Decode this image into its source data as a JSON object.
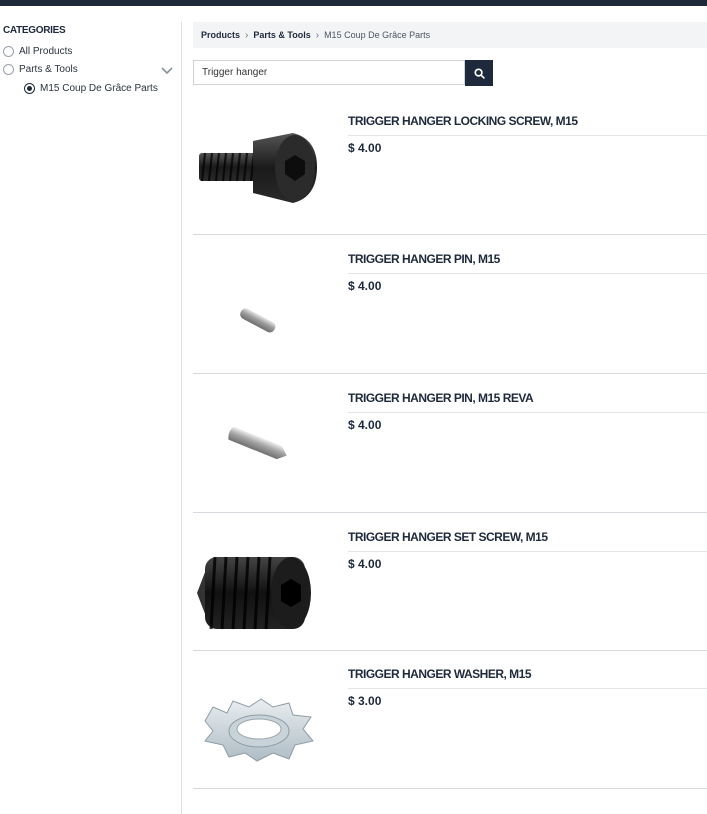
{
  "sidebar": {
    "title": "CATEGORIES",
    "items": [
      {
        "label": "All Products",
        "checked": false
      },
      {
        "label": "Parts & Tools",
        "checked": false
      },
      {
        "label": "M15 Coup De Grâce Parts",
        "checked": true
      }
    ]
  },
  "breadcrumb": {
    "items": [
      "Products",
      "Parts & Tools"
    ],
    "current": "M15 Coup De Grâce Parts"
  },
  "search": {
    "value": "Trigger hanger",
    "icon": "search-icon"
  },
  "products": [
    {
      "name": "TRIGGER HANGER LOCKING SCREW, M15",
      "price": "$ 4.00",
      "image": "socket-head-screw"
    },
    {
      "name": "TRIGGER HANGER PIN, M15",
      "price": "$ 4.00",
      "image": "small-pin"
    },
    {
      "name": "TRIGGER HANGER PIN, M15 REVA",
      "price": "$ 4.00",
      "image": "pin"
    },
    {
      "name": "TRIGGER HANGER SET SCREW, M15",
      "price": "$ 4.00",
      "image": "set-screw"
    },
    {
      "name": "TRIGGER HANGER WASHER, M15",
      "price": "$ 3.00",
      "image": "star-washer"
    }
  ],
  "colors": {
    "primary": "#1e2a3b",
    "breadcrumb_bg": "#f3f4f6"
  }
}
